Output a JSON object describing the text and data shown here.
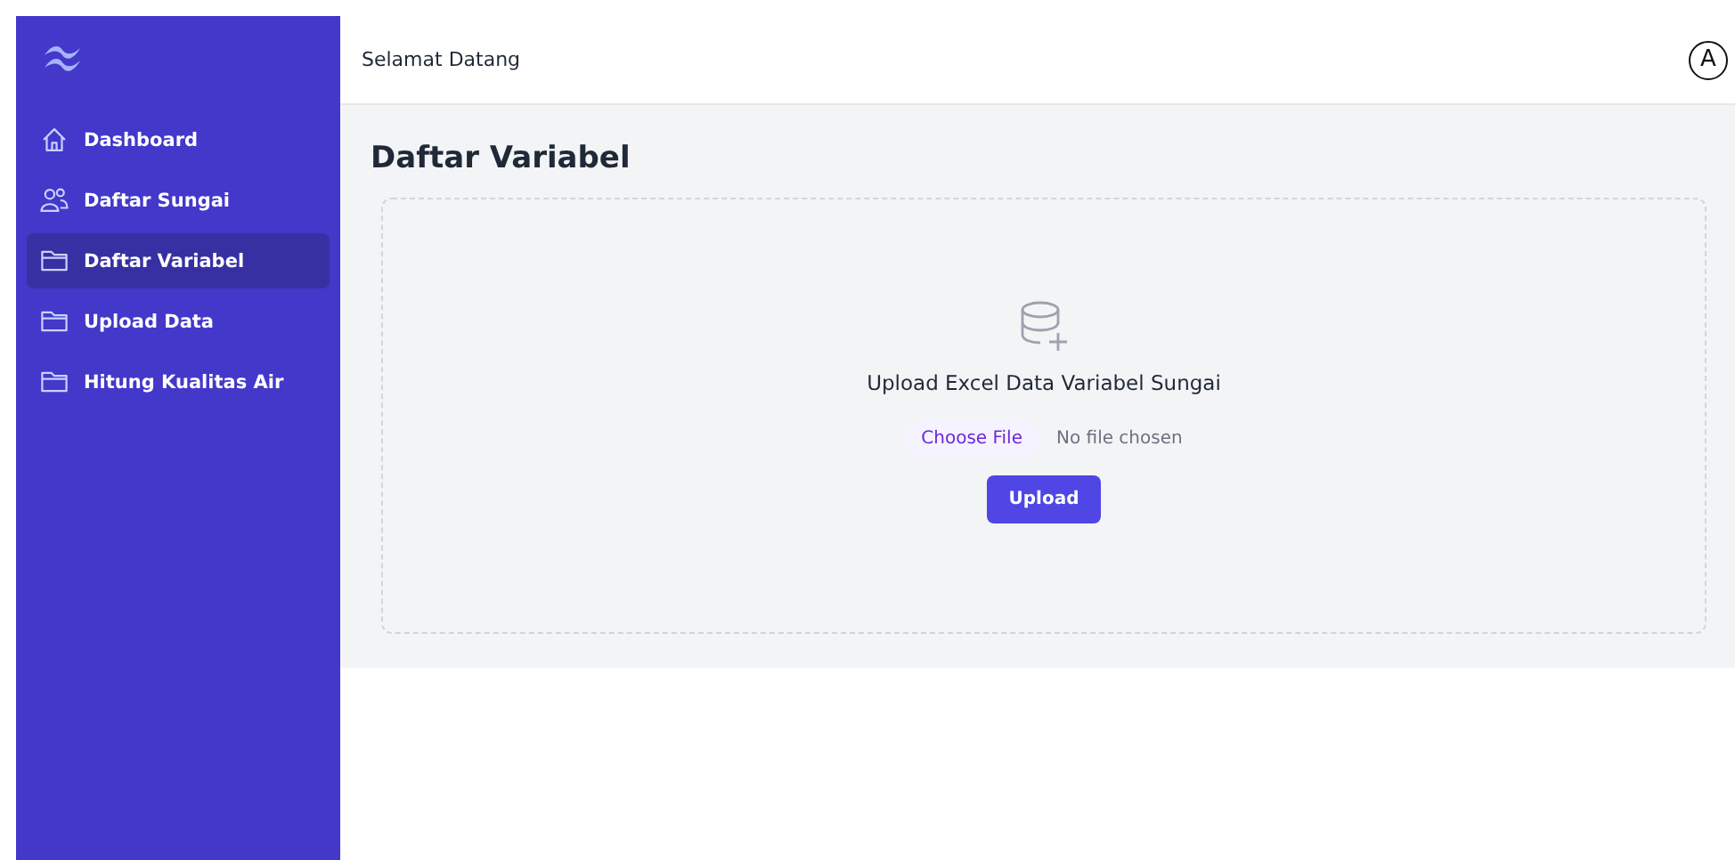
{
  "sidebar": {
    "items": [
      {
        "label": "Dashboard",
        "kind": "home",
        "selected": false
      },
      {
        "label": "Daftar Sungai",
        "kind": "users",
        "selected": false
      },
      {
        "label": "Daftar Variabel",
        "kind": "folder",
        "selected": true
      },
      {
        "label": "Upload Data",
        "kind": "folder",
        "selected": false
      },
      {
        "label": "Hitung Kualitas Air",
        "kind": "folder",
        "selected": false
      }
    ]
  },
  "header": {
    "greeting": "Selamat Datang",
    "avatar": "A"
  },
  "page": {
    "title": "Daftar Variabel",
    "upload": {
      "heading": "Upload Excel Data Variabel Sungai",
      "choose_button": "Choose File",
      "file_status": "No file chosen",
      "submit_button": "Upload"
    }
  }
}
